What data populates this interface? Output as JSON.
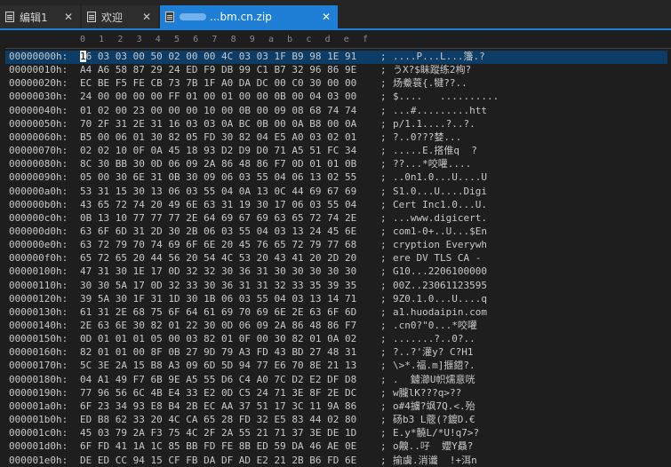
{
  "tabs": [
    {
      "label": "编辑1",
      "close": "✕"
    },
    {
      "label": "欢迎",
      "close": "✕"
    },
    {
      "label": "...bm.cn.zip",
      "close": "✕"
    }
  ],
  "ruler": [
    "0",
    "1",
    "2",
    "3",
    "4",
    "5",
    "6",
    "7",
    "8",
    "9",
    "a",
    "b",
    "c",
    "d",
    "e",
    "f"
  ],
  "rows": [
    {
      "addr": "00000000h:",
      "hex": "16 03 03 00 50 02 00 00 4C 03 03 1F B9 98 1E 91",
      "ascii": "....P...L...籓.?"
    },
    {
      "addr": "00000010h:",
      "hex": "A4 A6 58 87 29 24 ED F9 DB 99 C1 B7 32 96 86 9E",
      "ascii": "うX?$眛蹤练2栒?"
    },
    {
      "addr": "00000020h:",
      "hex": "EC BE F5 FE CB 73 7B 1F A0 DA DC 00 C0 30 00 00",
      "ascii": "炀鯗蓑{.犍??.."
    },
    {
      "addr": "00000030h:",
      "hex": "24 00 00 00 00 FF 01 00 01 00 00 0B 00 04 03 00",
      "ascii": "$....   .........."
    },
    {
      "addr": "00000040h:",
      "hex": "01 02 00 23 00 00 00 10 00 0B 00 09 08 68 74 74",
      "ascii": "...#.........htt"
    },
    {
      "addr": "00000050h:",
      "hex": "70 2F 31 2E 31 16 03 03 0A BC 0B 00 0A B8 00 0A",
      "ascii": "p/1.1....?..?."
    },
    {
      "addr": "00000060h:",
      "hex": "B5 00 06 01 30 82 05 FD 30 82 04 E5 A0 03 02 01",
      "ascii": "?..0???婪..."
    },
    {
      "addr": "00000070h:",
      "hex": "02 02 10 0F 0A 45 18 93 D2 D9 D0 71 A5 51 FC 34",
      "ascii": ".....E.搭倠q  ?"
    },
    {
      "addr": "00000080h:",
      "hex": "8C 30 BB 30 0D 06 09 2A 86 48 86 F7 0D 01 01 0B",
      "ascii": "??...*咬嚾...."
    },
    {
      "addr": "00000090h:",
      "hex": "05 00 30 6E 31 0B 30 09 06 03 55 04 06 13 02 55",
      "ascii": "..0n1.0...U....U"
    },
    {
      "addr": "000000a0h:",
      "hex": "53 31 15 30 13 06 03 55 04 0A 13 0C 44 69 67 69",
      "ascii": "S1.0...U....Digi"
    },
    {
      "addr": "000000b0h:",
      "hex": "43 65 72 74 20 49 6E 63 31 19 30 17 06 03 55 04",
      "ascii": "Cert Inc1.0...U."
    },
    {
      "addr": "000000c0h:",
      "hex": "0B 13 10 77 77 77 2E 64 69 67 69 63 65 72 74 2E",
      "ascii": "...www.digicert."
    },
    {
      "addr": "000000d0h:",
      "hex": "63 6F 6D 31 2D 30 2B 06 03 55 04 03 13 24 45 6E",
      "ascii": "com1-0+..U...$En"
    },
    {
      "addr": "000000e0h:",
      "hex": "63 72 79 70 74 69 6F 6E 20 45 76 65 72 79 77 68",
      "ascii": "cryption Everywh"
    },
    {
      "addr": "000000f0h:",
      "hex": "65 72 65 20 44 56 20 54 4C 53 20 43 41 20 2D 20",
      "ascii": "ere DV TLS CA - "
    },
    {
      "addr": "00000100h:",
      "hex": "47 31 30 1E 17 0D 32 32 30 36 31 30 30 30 30 30",
      "ascii": "G10...2206100000"
    },
    {
      "addr": "00000110h:",
      "hex": "30 30 5A 17 0D 32 33 30 36 31 31 32 33 35 39 35",
      "ascii": "00Z..23061123595"
    },
    {
      "addr": "00000120h:",
      "hex": "39 5A 30 1F 31 1D 30 1B 06 03 55 04 03 13 14 71",
      "ascii": "9Z0.1.0...U....q"
    },
    {
      "addr": "00000130h:",
      "hex": "61 31 2E 68 75 6F 64 61 69 70 69 6E 2E 63 6F 6D",
      "ascii": "a1.huodaipin.com"
    },
    {
      "addr": "00000140h:",
      "hex": "2E 63 6E 30 82 01 22 30 0D 06 09 2A 86 48 86 F7",
      "ascii": ".cn0?\"0...*咬嚾"
    },
    {
      "addr": "00000150h:",
      "hex": "0D 01 01 01 05 00 03 82 01 0F 00 30 82 01 0A 02",
      "ascii": ".......?..0?.."
    },
    {
      "addr": "00000160h:",
      "hex": "82 01 01 00 8F 0B 27 9D 79 A3 FD 43 BD 27 48 31",
      "ascii": "?..?'灌y? C?H1"
    },
    {
      "addr": "00000170h:",
      "hex": "5C 3E 2A 15 B8 A3 09 6D 5D 94 77 E6 70 8E 21 13",
      "ascii": "\\>*.福.m]擓鍣?."
    },
    {
      "addr": "00000180h:",
      "hex": "04 A1 49 F7 6B 9E A5 55 D6 C4 A0 7C D2 E2 DF D8",
      "ascii": ".  鑢瀄U帜燸意咣"
    },
    {
      "addr": "00000190h:",
      "hex": "77 96 56 6C 4B E4 33 E2 0D C5 24 71 3E 8F 2E DC",
      "ascii": "w朧lK???q>??"
    },
    {
      "addr": "000001a0h:",
      "hex": "6F 23 34 93 E8 B4 2B EC AA 37 51 17 3C 11 9A 86",
      "ascii": "o#4擄?飒7Q.<.殆"
    },
    {
      "addr": "000001b0h:",
      "hex": "ED B8 62 33 20 4C CA 65 28 FD 32 E5 83 44 02 80",
      "ascii": "砀b3 L蔲(?鍍D.€"
    },
    {
      "addr": "000001c0h:",
      "hex": "45 03 79 2A F3 75 4C 2F 2A 55 21 71 37 3E DE 1D",
      "ascii": "E.y*髐L/*U!q7>?"
    },
    {
      "addr": "000001d0h:",
      "hex": "6F FD 41 1A 1C 85 BB FD FE 8B ED 59 DA 46 AE 0E",
      "ascii": "o齅..吇  孆Y贔?"
    },
    {
      "addr": "000001e0h:",
      "hex": "DE ED CC 94 15 CF FB DA DF AD E2 21 2B B6 FD 6E",
      "ascii": "揄虜.消谶  !+洱n"
    }
  ]
}
